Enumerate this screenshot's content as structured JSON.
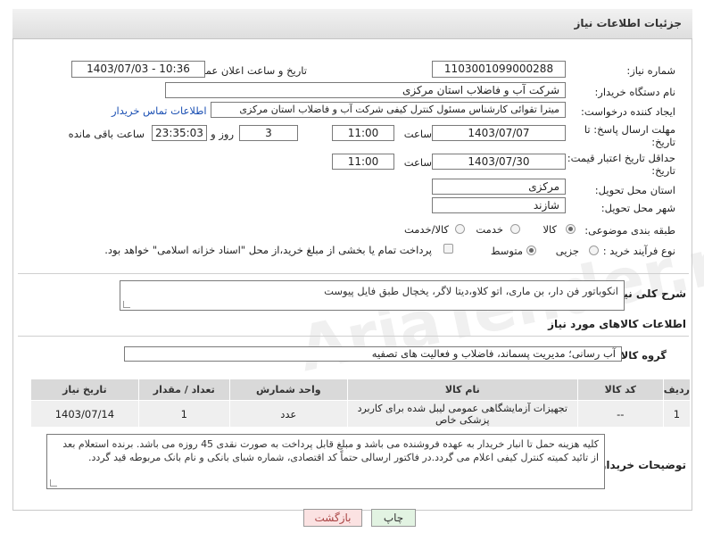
{
  "header": {
    "title": "جزئیات اطلاعات نیاز"
  },
  "fields": {
    "need_number_label": "شماره نیاز:",
    "need_number": "1103001099000288",
    "announce_label": "تاریخ و ساعت اعلان عمومی:",
    "announce_value": "1403/07/03 - 10:36",
    "buyer_org_label": "نام دستگاه خریدار:",
    "buyer_org": "شرکت آب و فاضلاب استان مرکزی",
    "creator_label": "ایجاد کننده درخواست:",
    "creator": "میترا تقوائی کارشناس مسئول کنترل کیفی شرکت آب و فاضلاب استان مرکزی",
    "contact_link": "اطلاعات تماس خریدار",
    "reply_deadline_label_1": "مهلت ارسال پاسخ: تا",
    "reply_deadline_label_2": "تاریخ:",
    "reply_date": "1403/07/07",
    "time_label": "ساعت",
    "reply_time": "11:00",
    "days_value": "3",
    "days_label": "روز و",
    "remaining_value": "23:35:03",
    "remaining_label": "ساعت باقی مانده",
    "validity_label_1": "حداقل تاریخ اعتبار قیمت: تا",
    "validity_label_2": "تاریخ:",
    "validity_date": "1403/07/30",
    "validity_time": "11:00",
    "province_label": "استان محل تحویل:",
    "province": "مرکزی",
    "city_label": "شهر محل تحویل:",
    "city": "شازند",
    "category_label": "طبقه بندی موضوعی:",
    "category_options": [
      "کالا",
      "خدمت",
      "کالا/خدمت"
    ],
    "process_label": "نوع فرآیند خرید :",
    "process_options": [
      "جزیی",
      "متوسط"
    ],
    "payment_note": "پرداخت تمام یا بخشی از مبلغ خرید،از محل \"اسناد خزانه اسلامی\" خواهد بود."
  },
  "summary": {
    "label": "شرح کلی نیاز:",
    "text": "انکوباتور فن دار، بن ماری، اتو کلاو،دیتا لاگر، یخچال طبق فایل پیوست"
  },
  "goods": {
    "section_title": "اطلاعات کالاهای مورد نیاز",
    "group_label": "گروه کالا:",
    "group_value": "آب رسانی؛ مدیریت پسماند، فاضلاب و فعالیت های تصفیه",
    "columns": [
      "ردیف",
      "کد کالا",
      "نام کالا",
      "واحد شمارش",
      "تعداد / مقدار",
      "تاریخ نیاز"
    ],
    "rows": [
      {
        "row": "1",
        "code": "--",
        "name": "تجهیزات آزمایشگاهی عمومی لیبل شده برای کاربرد پزشکی خاص",
        "unit": "عدد",
        "qty": "1",
        "date": "1403/07/14"
      }
    ]
  },
  "buyer_notes": {
    "label": "توضیحات خریدار:",
    "text": "کلیه هزینه حمل تا انبار خریدار به عهده فروشنده می باشد و مبلغ قابل پرداخت به صورت نقدی 45 روزه می باشد. برنده استعلام بعد از تائید کمیته کنترل کیفی اعلام می گردد.در فاکتور ارسالی حتماً کد اقتصادی، شماره شبای بانکی و نام بانک مربوطه قید گردد."
  },
  "buttons": {
    "print": "چاپ",
    "back": "بازگشت"
  },
  "watermark": "AriaTender.neT"
}
